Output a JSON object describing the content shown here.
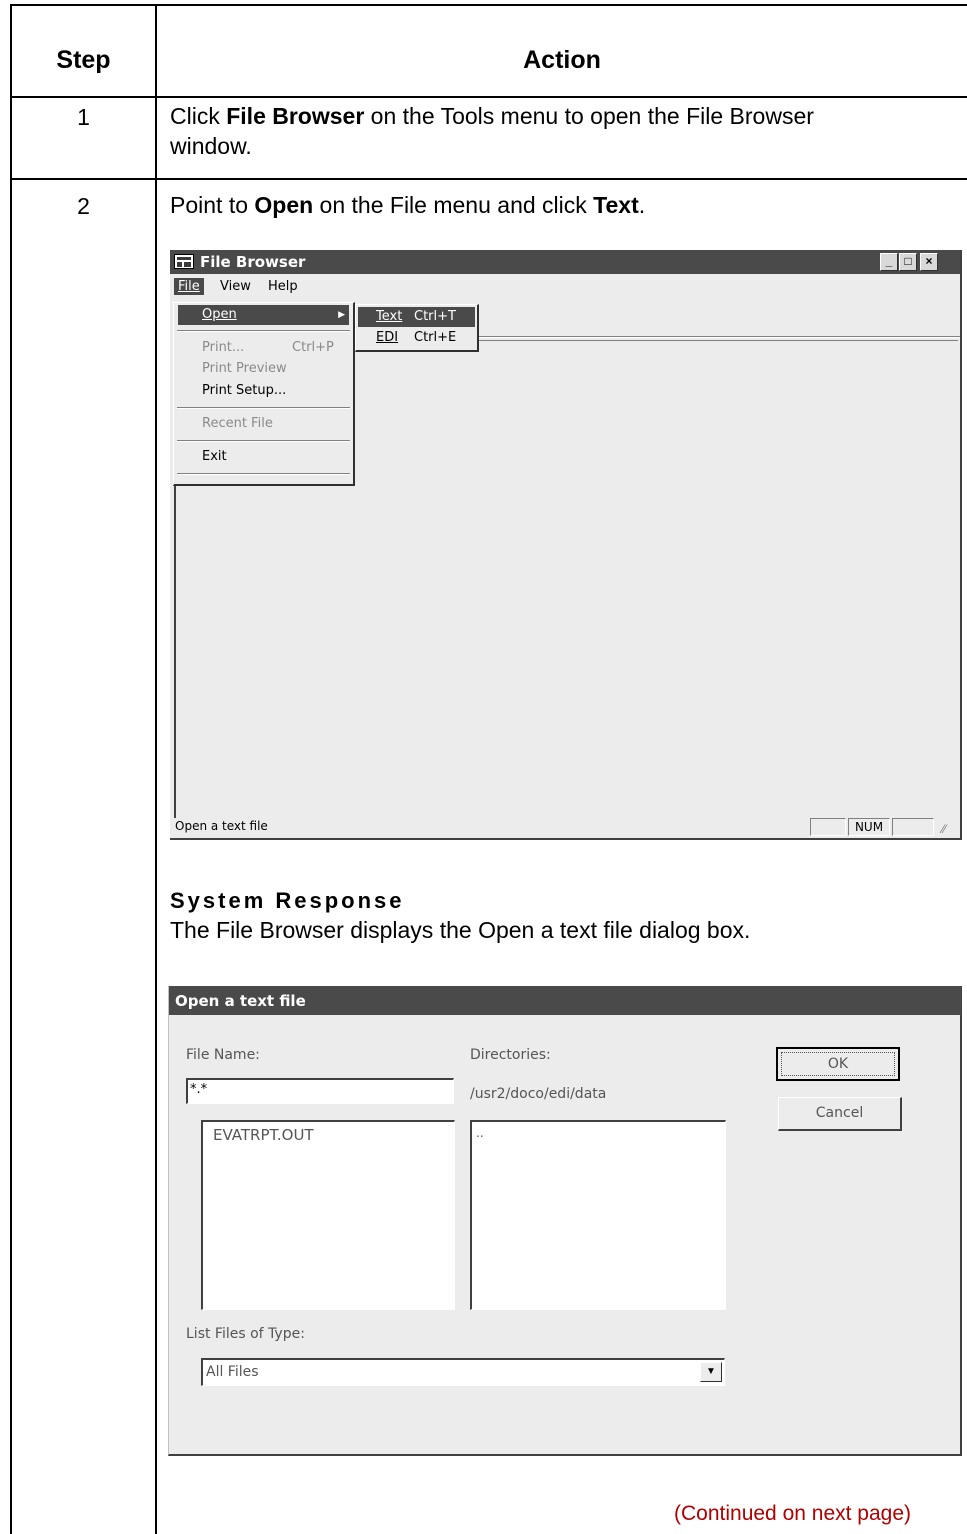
{
  "table": {
    "headers": {
      "step": "Step",
      "action": "Action"
    },
    "rows": [
      {
        "step": "1",
        "pre1": "Click ",
        "bold1": "File Browser",
        "post1": " on the Tools menu to open the File Browser",
        "line2": "window."
      },
      {
        "step": "2",
        "pre1": "Point to ",
        "bold1": "Open",
        "mid": " on the File menu and click ",
        "bold2": "Text",
        "post": "."
      }
    ]
  },
  "file_browser": {
    "title": "File Browser",
    "menubar": [
      "File",
      "View",
      "Help"
    ],
    "file_menu": {
      "open": "Open",
      "print": "Print...",
      "print_shortcut": "Ctrl+P",
      "print_preview": "Print Preview",
      "print_setup": "Print Setup...",
      "recent_file": "Recent File",
      "exit": "Exit"
    },
    "submenu": [
      {
        "label": "Text",
        "shortcut": "Ctrl+T"
      },
      {
        "label": "EDI",
        "shortcut": "Ctrl+E"
      }
    ],
    "status_text": "Open a text file",
    "status_indicator": "NUM"
  },
  "system_response": {
    "heading": "System Response",
    "text": "The File Browser displays the Open a text file dialog box."
  },
  "open_dialog": {
    "title": "Open a text file",
    "file_name_label": "File Name:",
    "file_name_value": "*.*",
    "directories_label": "Directories:",
    "directory_path": "/usr2/doco/edi/data",
    "files": [
      "EVATRPT.OUT"
    ],
    "directories": [
      ".."
    ],
    "ok_label": "OK",
    "cancel_label": "Cancel",
    "list_type_label": "List Files of Type:",
    "list_type_value": "All Files"
  },
  "footer": {
    "continued": "(Continued on next page)"
  }
}
